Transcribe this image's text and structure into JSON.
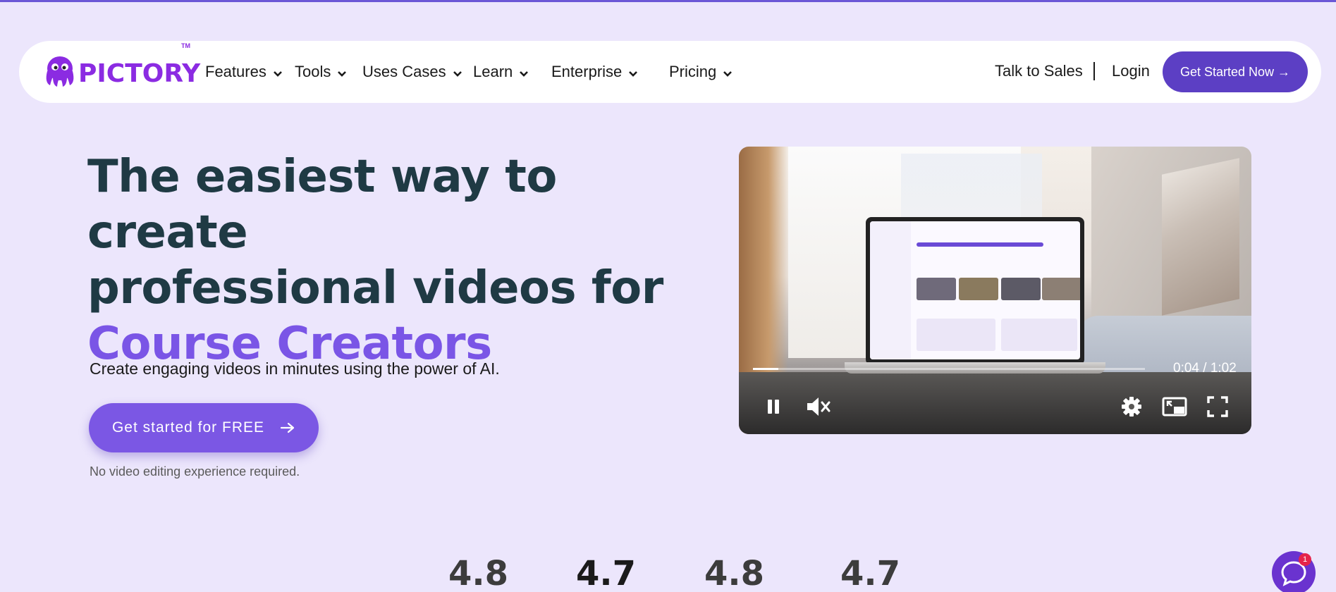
{
  "brand": {
    "name": "PICTORY",
    "trademark": "TM",
    "color": "#8b2be2"
  },
  "nav": {
    "items": [
      {
        "label": "Features"
      },
      {
        "label": "Tools"
      },
      {
        "label": "Uses Cases"
      },
      {
        "label": "Learn"
      },
      {
        "label": "Enterprise"
      },
      {
        "label": "Pricing"
      }
    ],
    "talk_to_sales": "Talk to Sales",
    "login": "Login",
    "get_started": "Get Started Now →"
  },
  "hero": {
    "title_line1": "The easiest way to create",
    "title_line2": "professional videos for",
    "title_accent": "Course Creators",
    "subtitle": "Create engaging videos in minutes using the power of AI.",
    "cta_label": "Get started for FREE",
    "note": "No video editing experience required."
  },
  "video": {
    "time": "0:04 / 1:02",
    "progress_fraction": 0.065,
    "controls": [
      "pause-icon",
      "mute-icon",
      "settings-icon",
      "picture-in-picture-icon",
      "fullscreen-icon"
    ]
  },
  "ratings": [
    "4.8",
    "4.7",
    "4.8",
    "4.7"
  ],
  "chat": {
    "badge": "1"
  },
  "colors": {
    "background": "#ece6fc",
    "accent": "#7a55e6",
    "nav_button": "#5c3fc4",
    "cta": "#7b57e4",
    "heading": "#1f3a44"
  }
}
